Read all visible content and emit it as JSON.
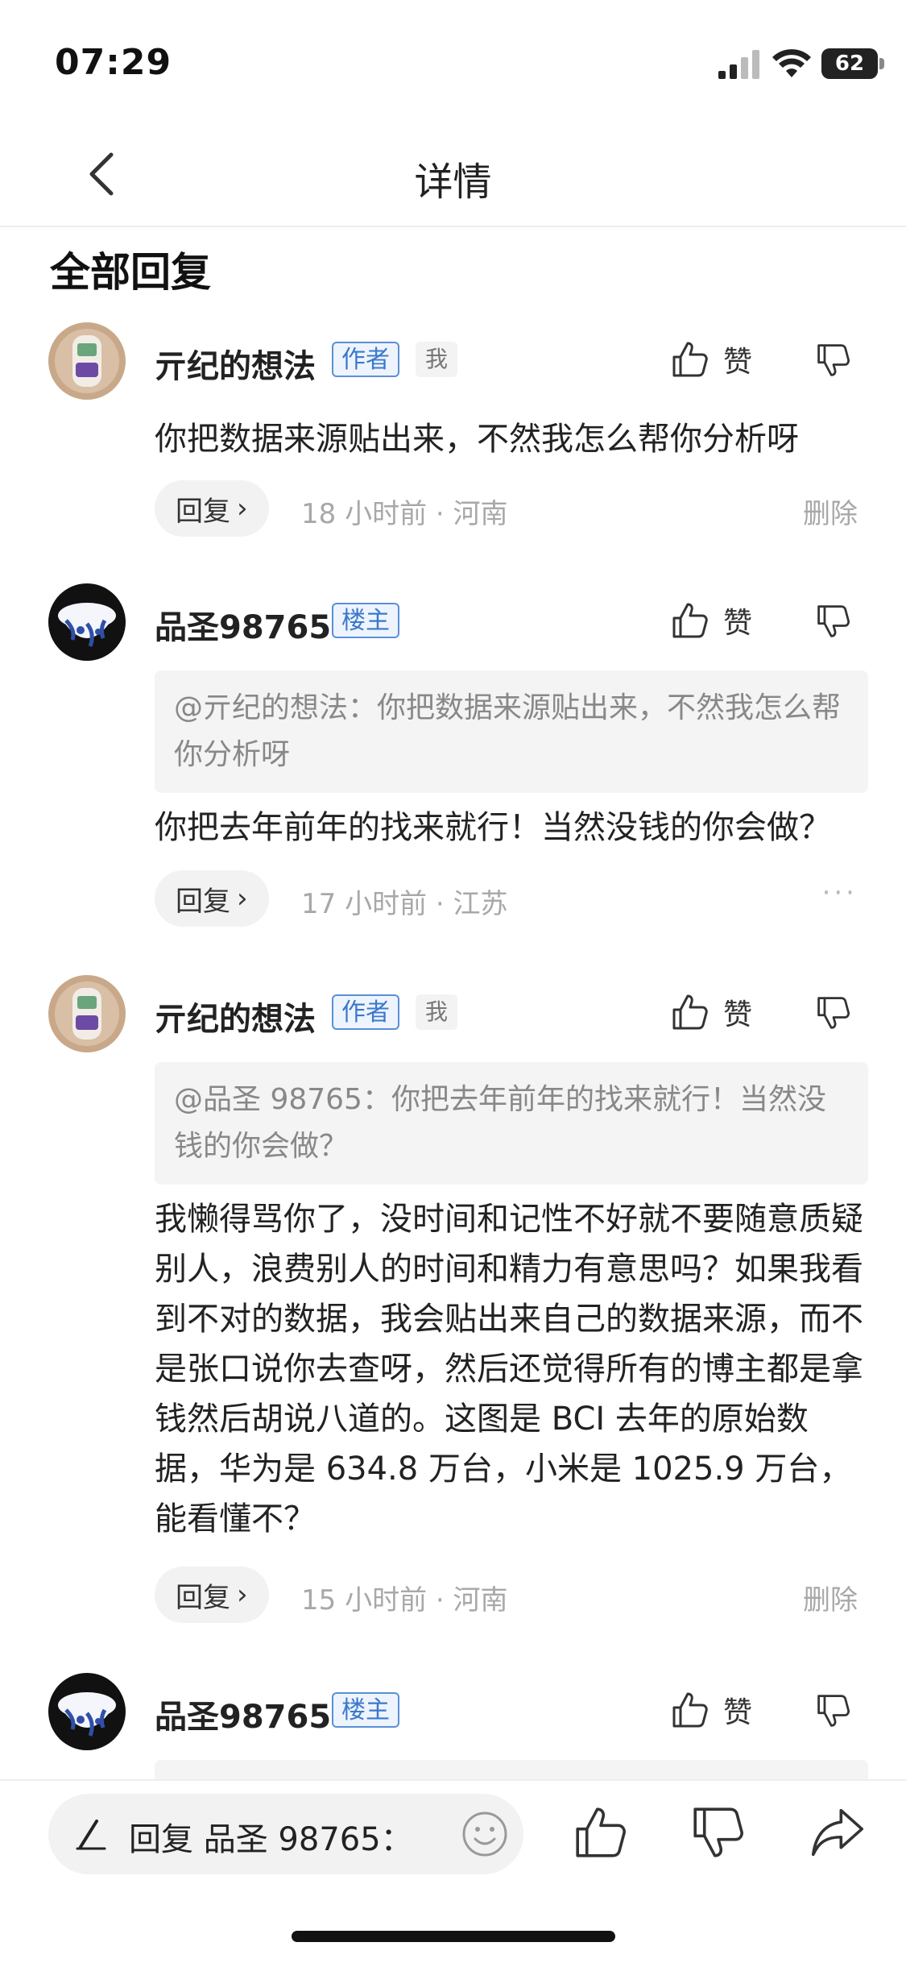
{
  "status_bar": {
    "time": "07:29",
    "battery": "62"
  },
  "nav": {
    "title": "详情"
  },
  "section_title": "全部回复",
  "comments": [
    {
      "username": "亓纪的想法",
      "tag": "作者",
      "me_tag": "我",
      "like_label": "赞",
      "body": "你把数据来源贴出来，不然我怎么帮你分析呀",
      "reply_label": "回复",
      "meta": "18 小时前 · 河南",
      "action": "删除"
    },
    {
      "username": "品圣98765",
      "tag": "楼主",
      "like_label": "赞",
      "quote": "@亓纪的想法：你把数据来源贴出来，不然我怎么帮你分析呀",
      "body": "你把去年前年的找来就行！当然没钱的你会做？",
      "reply_label": "回复",
      "meta": "17 小时前 · 江苏",
      "action": "···"
    },
    {
      "username": "亓纪的想法",
      "tag": "作者",
      "me_tag": "我",
      "like_label": "赞",
      "quote": "@品圣 98765：你把去年前年的找来就行！当然没钱的你会做？",
      "body": "我懒得骂你了，没时间和记性不好就不要随意质疑别人，浪费别人的时间和精力有意思吗？如果我看到不对的数据，我会贴出来自己的数据来源，而不是张口说你去查呀，然后还觉得所有的博主都是拿钱然后胡说八道的。这图是 BCI 去年的原始数据，华为是 634.8 万台，小米是 1025.9 万台，能看懂不？",
      "reply_label": "回复",
      "meta": "15 小时前 · 河南",
      "action": "删除"
    },
    {
      "username": "品圣98765",
      "tag": "楼主",
      "like_label": "赞"
    }
  ],
  "bottom_bar": {
    "input_text": "回复 品圣 98765："
  },
  "icons": {
    "back": "chevron-left-icon",
    "like": "thumbs-up-icon",
    "dislike": "thumbs-down-icon",
    "pen": "pen-icon",
    "emoji": "smiley-icon",
    "share": "share-icon"
  },
  "colors": {
    "tag_border": "#5b8fd6",
    "tag_text": "#3b78cc",
    "meta": "#a8a8a8",
    "quote_bg": "#f4f4f4"
  }
}
